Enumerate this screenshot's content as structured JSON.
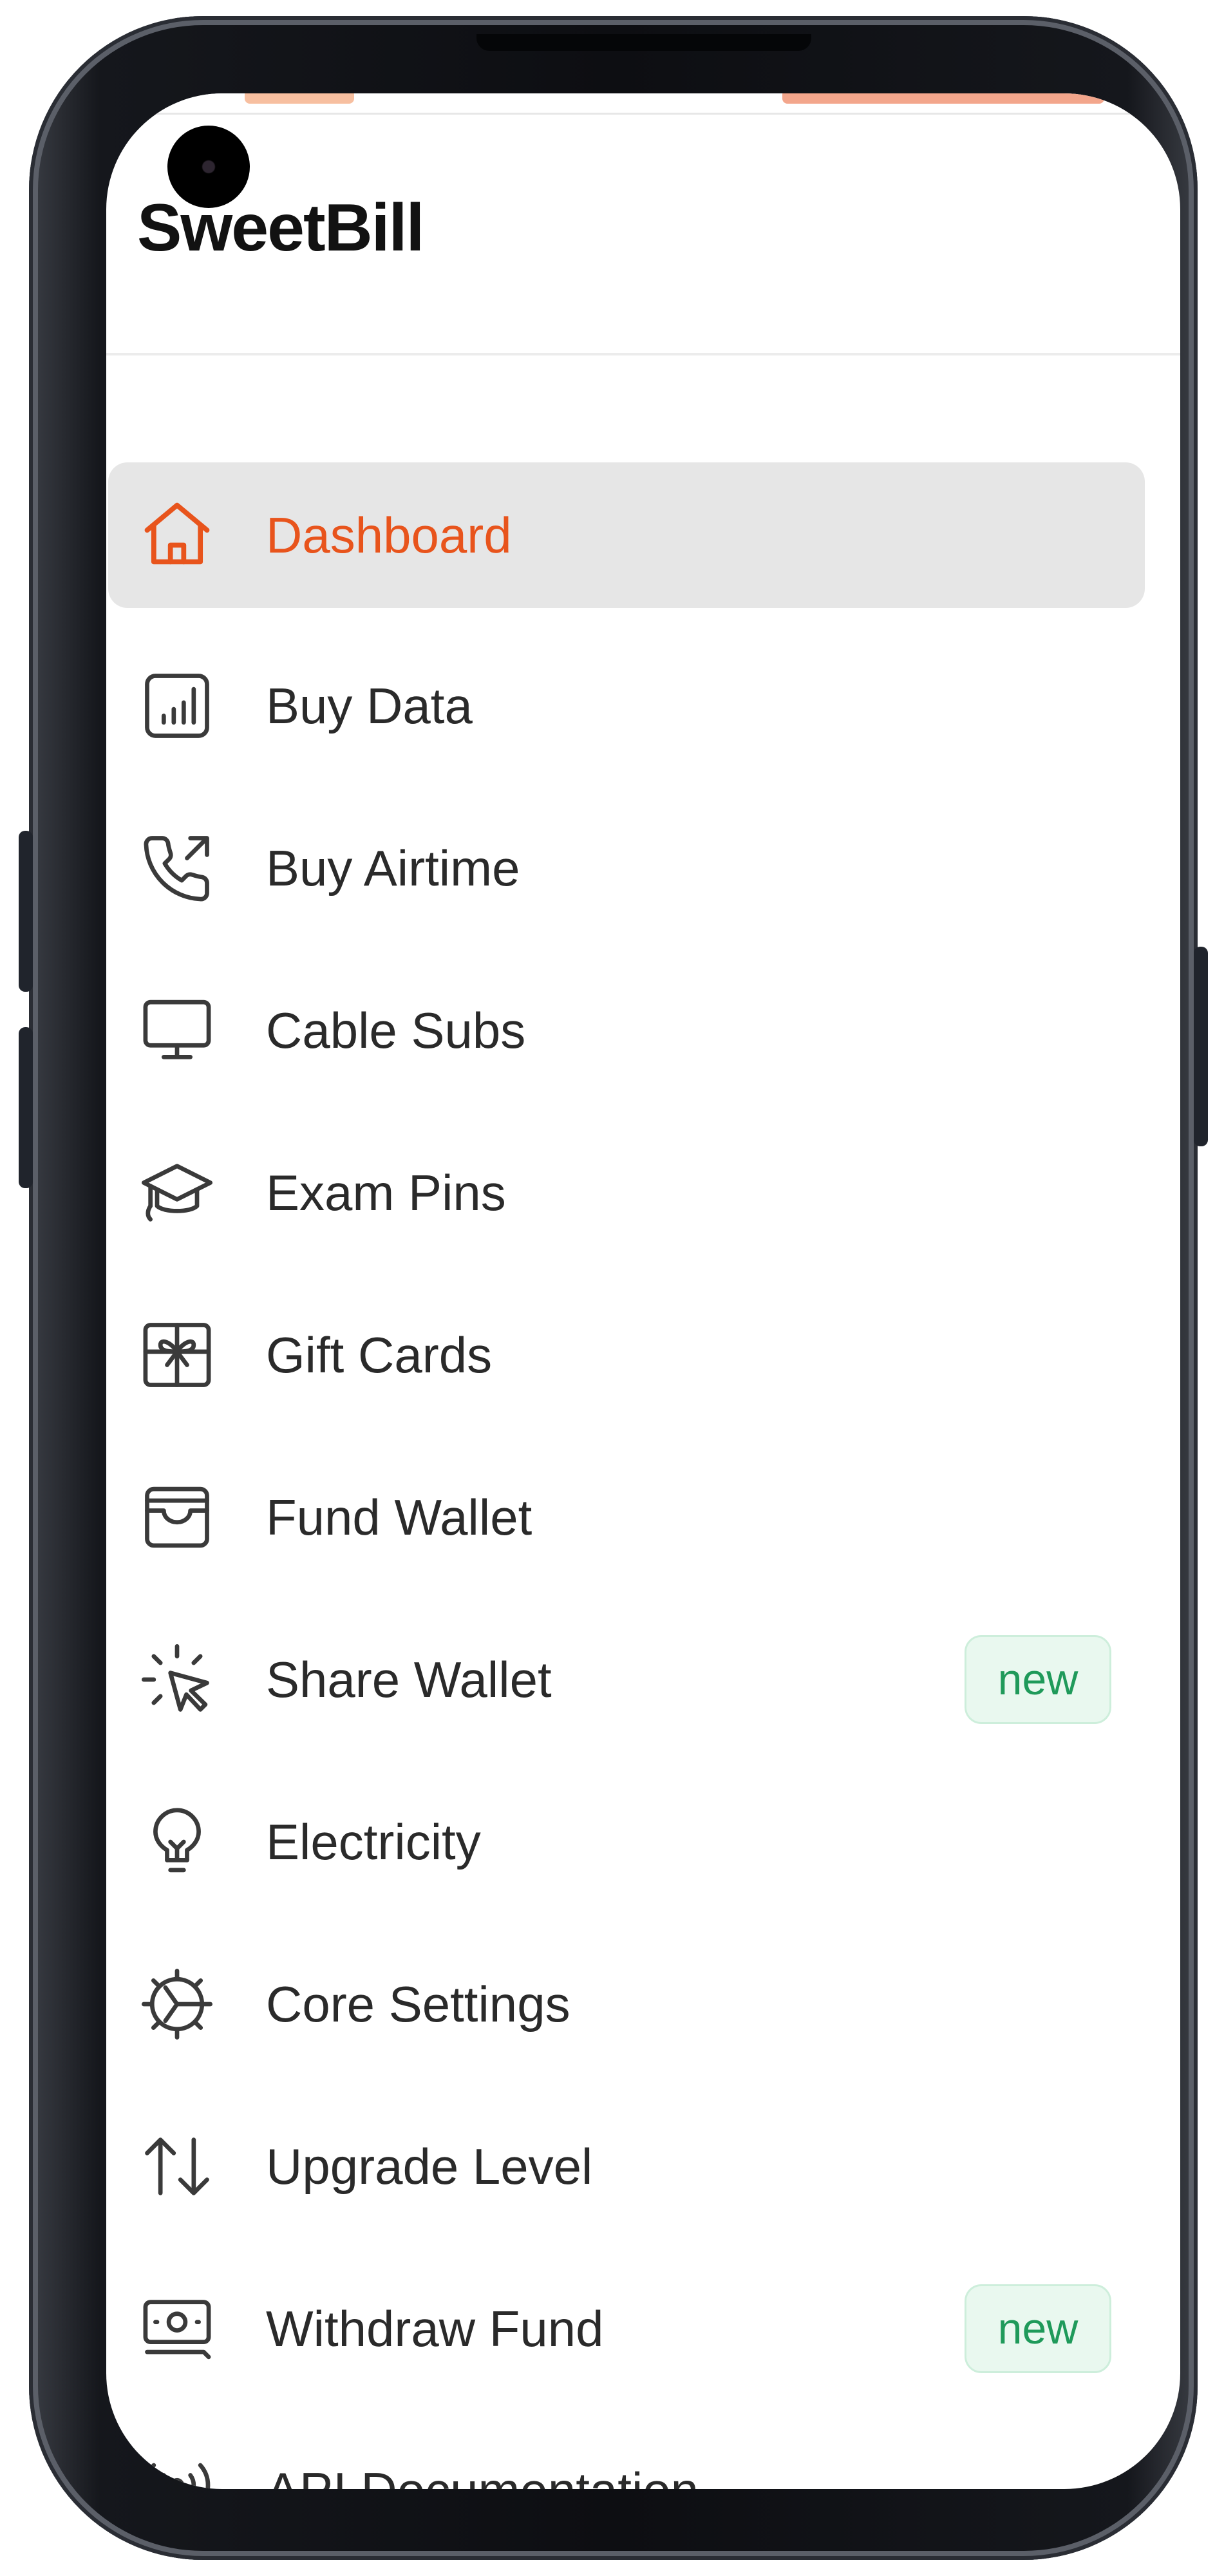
{
  "app": {
    "title": "SweetBill"
  },
  "colors": {
    "accent": "#e8541c",
    "active_bg": "#e6e6e6",
    "badge_bg": "#e9f8ef",
    "badge_text": "#1f9a5a"
  },
  "sidebar": {
    "items": [
      {
        "label": "Dashboard",
        "icon": "home-icon",
        "active": true
      },
      {
        "label": "Buy Data",
        "icon": "signal-bars-icon"
      },
      {
        "label": "Buy Airtime",
        "icon": "phone-outgoing-icon"
      },
      {
        "label": "Cable Subs",
        "icon": "monitor-icon"
      },
      {
        "label": "Exam Pins",
        "icon": "graduation-cap-icon"
      },
      {
        "label": "Gift Cards",
        "icon": "gift-icon"
      },
      {
        "label": "Fund Wallet",
        "icon": "wallet-icon"
      },
      {
        "label": "Share Wallet",
        "icon": "cursor-click-icon",
        "badge": "new"
      },
      {
        "label": "Electricity",
        "icon": "lightbulb-icon"
      },
      {
        "label": "Core Settings",
        "icon": "gear-icon"
      },
      {
        "label": "Upgrade Level",
        "icon": "arrows-up-down-icon"
      },
      {
        "label": "Withdraw Fund",
        "icon": "cash-icon",
        "badge": "new"
      },
      {
        "label": "API Documentation",
        "icon": "broadcast-icon"
      }
    ]
  }
}
